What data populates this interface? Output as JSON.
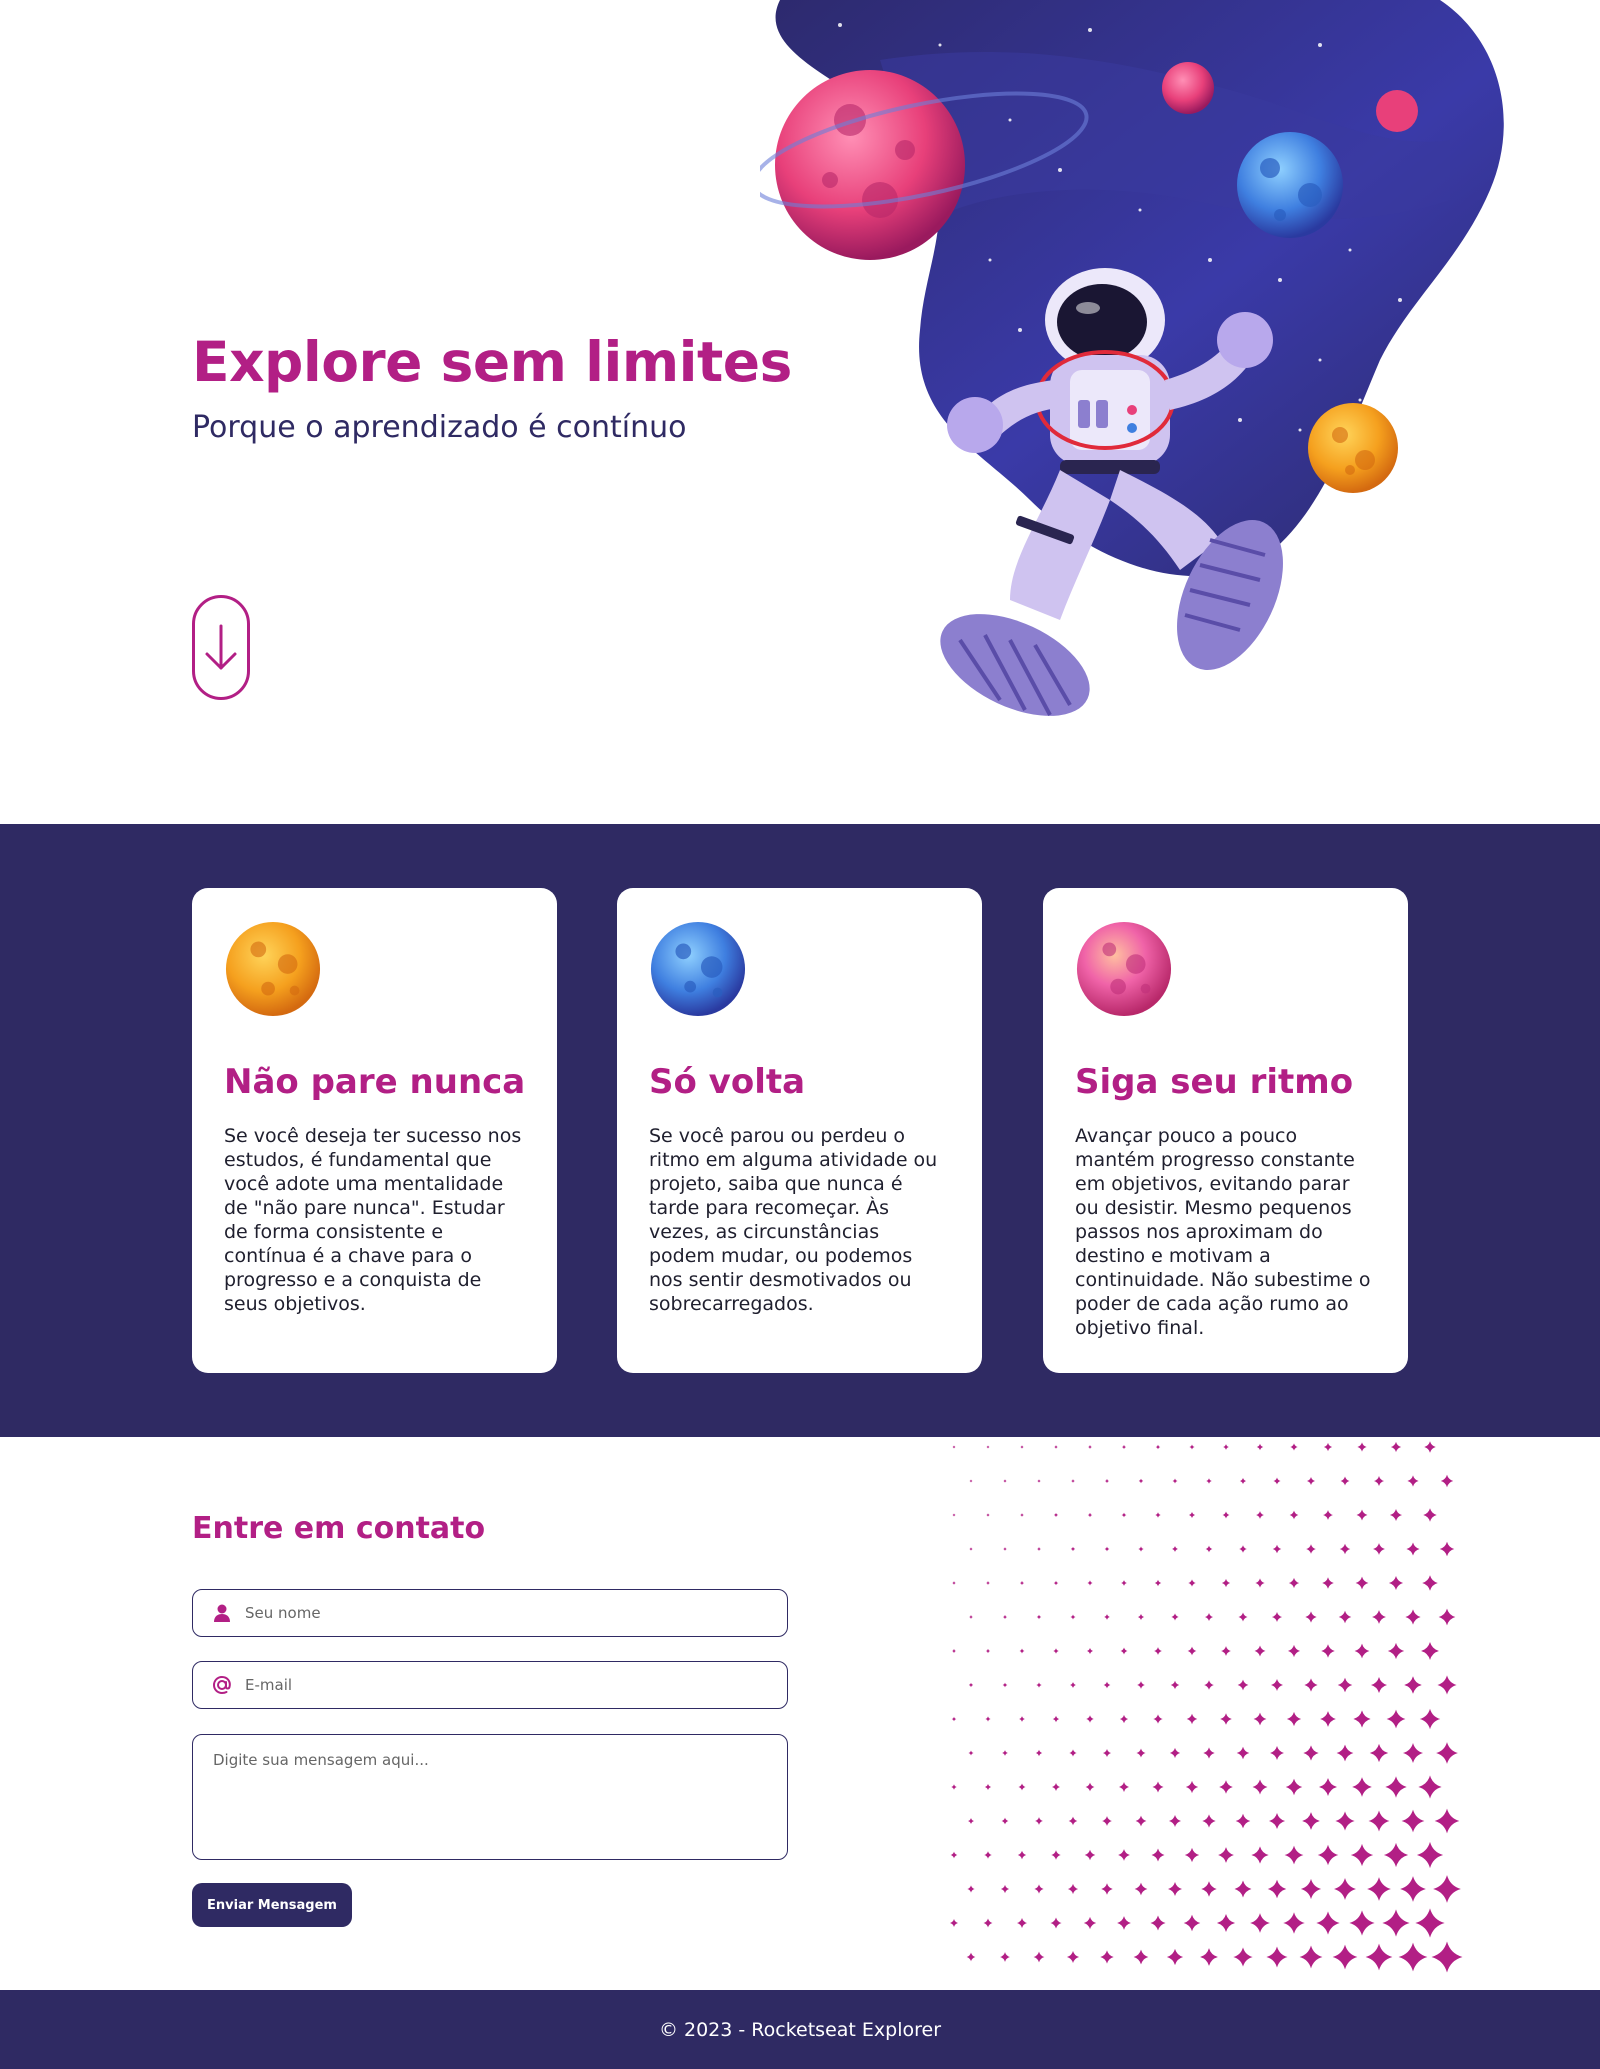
{
  "hero": {
    "title": "Explore sem limites",
    "subtitle": "Porque o aprendizado é contínuo",
    "scroll_icon": "arrow-down-icon",
    "illustration": "astronaut-space-illustration"
  },
  "cards": [
    {
      "planet": "orange-planet",
      "title": "Não pare nunca",
      "text": "Se você deseja ter sucesso nos estudos, é fundamental que você adote uma mentalidade de \"não pare nunca\". Estudar de forma consistente e contínua é a chave para o progresso e a conquista de seus objetivos."
    },
    {
      "planet": "blue-planet",
      "title": "Só volta",
      "text": "Se você parou ou perdeu o ritmo em alguma atividade ou projeto, saiba que nunca é tarde para recomeçar. Às vezes, as circunstâncias podem mudar, ou podemos nos sentir desmotivados ou sobrecarregados."
    },
    {
      "planet": "pink-planet",
      "title": "Siga seu ritmo",
      "text": "Avançar pouco a pouco mantém progresso constante em objetivos, evitando parar ou desistir. Mesmo pequenos passos nos aproximam do destino e motivam a continuidade. Não subestime o poder de cada ação rumo ao objetivo final."
    }
  ],
  "contact": {
    "title": "Entre em contato",
    "name_placeholder": "Seu nome",
    "name_icon": "user-icon",
    "email_placeholder": "E-mail",
    "email_icon": "at-icon",
    "message_placeholder": "Digite sua mensagem aqui...",
    "submit_label": "Enviar Mensagem"
  },
  "footer": {
    "text": "© 2023 - Rocketseat Explorer"
  },
  "colors": {
    "brand_pink": "#B21F85",
    "brand_navy": "#2F2A63",
    "white": "#FFFFFF"
  }
}
